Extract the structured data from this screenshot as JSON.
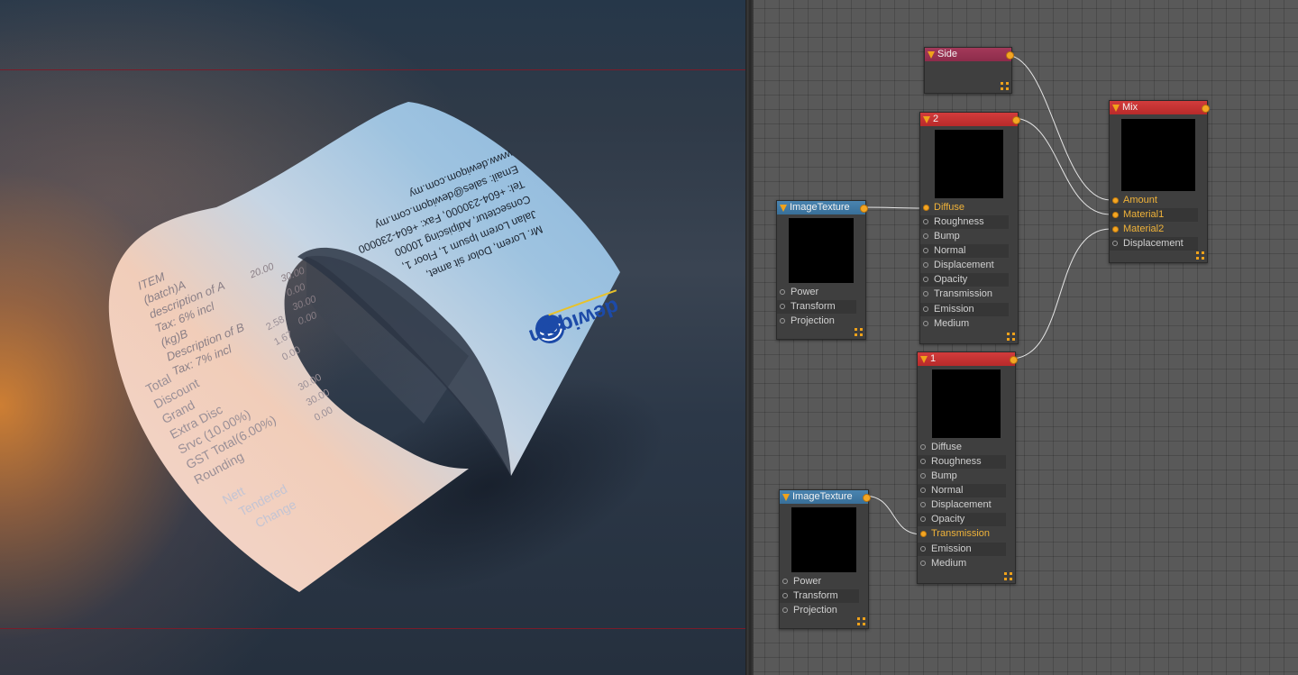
{
  "receipt": {
    "brand": "dewiqom",
    "header_lines": [
      "Mr. Lorem, Dolor sit amet,",
      "Jalan Lorem Ipsum 1, Floor 1,",
      "Consectetur, Adipiscing 10000",
      "Tel: +604-230000, Fax: +604-230000",
      "Email: sales@dewiqom.com.my",
      "www.dewiqom.com.my"
    ],
    "items": [
      {
        "label": "ITEM",
        "value": ""
      },
      {
        "label": "(batch)A",
        "value": ""
      },
      {
        "label": "description of A",
        "value": "20.00"
      },
      {
        "label": "Tax: 6% incl",
        "value": "30.00"
      },
      {
        "label": "(kg)B",
        "value": "0.00"
      },
      {
        "label": "Description of B",
        "value": "30.00"
      },
      {
        "label": "Tax: 7% incl",
        "value": "0.00"
      }
    ],
    "totals": [
      {
        "label": "Total",
        "value": "2.58"
      },
      {
        "label": "Discount",
        "value": "1.67"
      },
      {
        "label": "Grand",
        "value": "0.00"
      },
      {
        "label": "Extra Disc",
        "value": ""
      },
      {
        "label": "Srvc (10.00%)",
        "value": "30.00"
      },
      {
        "label": "GST Total(6.00%)",
        "value": "30.00"
      },
      {
        "label": "Rounding",
        "value": "0.00"
      },
      {
        "label": "Nett",
        "value": ""
      },
      {
        "label": "Tendered",
        "value": ""
      },
      {
        "label": "Change",
        "value": ""
      }
    ]
  },
  "nodes": {
    "side": {
      "title": "Side"
    },
    "material2": {
      "title": "2",
      "sockets": [
        "Diffuse",
        "Roughness",
        "Bump",
        "Normal",
        "Displacement",
        "Opacity",
        "Transmission",
        "Emission",
        "Medium"
      ],
      "connected": [
        "Diffuse"
      ]
    },
    "mix": {
      "title": "Mix",
      "sockets": [
        "Amount",
        "Material1",
        "Material2",
        "Displacement"
      ],
      "connected": [
        "Amount",
        "Material1",
        "Material2"
      ]
    },
    "imagetexture_top": {
      "title": "ImageTexture",
      "sockets": [
        "Power",
        "Transform",
        "Projection"
      ]
    },
    "material1": {
      "title": "1",
      "sockets": [
        "Diffuse",
        "Roughness",
        "Bump",
        "Normal",
        "Displacement",
        "Opacity",
        "Transmission",
        "Emission",
        "Medium"
      ],
      "connected": [
        "Transmission"
      ]
    },
    "imagetexture_bottom": {
      "title": "ImageTexture",
      "sockets": [
        "Power",
        "Transform",
        "Projection"
      ]
    }
  },
  "colors": {
    "material_header": "#c83333",
    "side_header": "#982f51",
    "texture_header": "#4179a5",
    "port_active": "#f4a623",
    "link_curve": "#e6e6e6",
    "frame_line": "#7a1c2a"
  }
}
